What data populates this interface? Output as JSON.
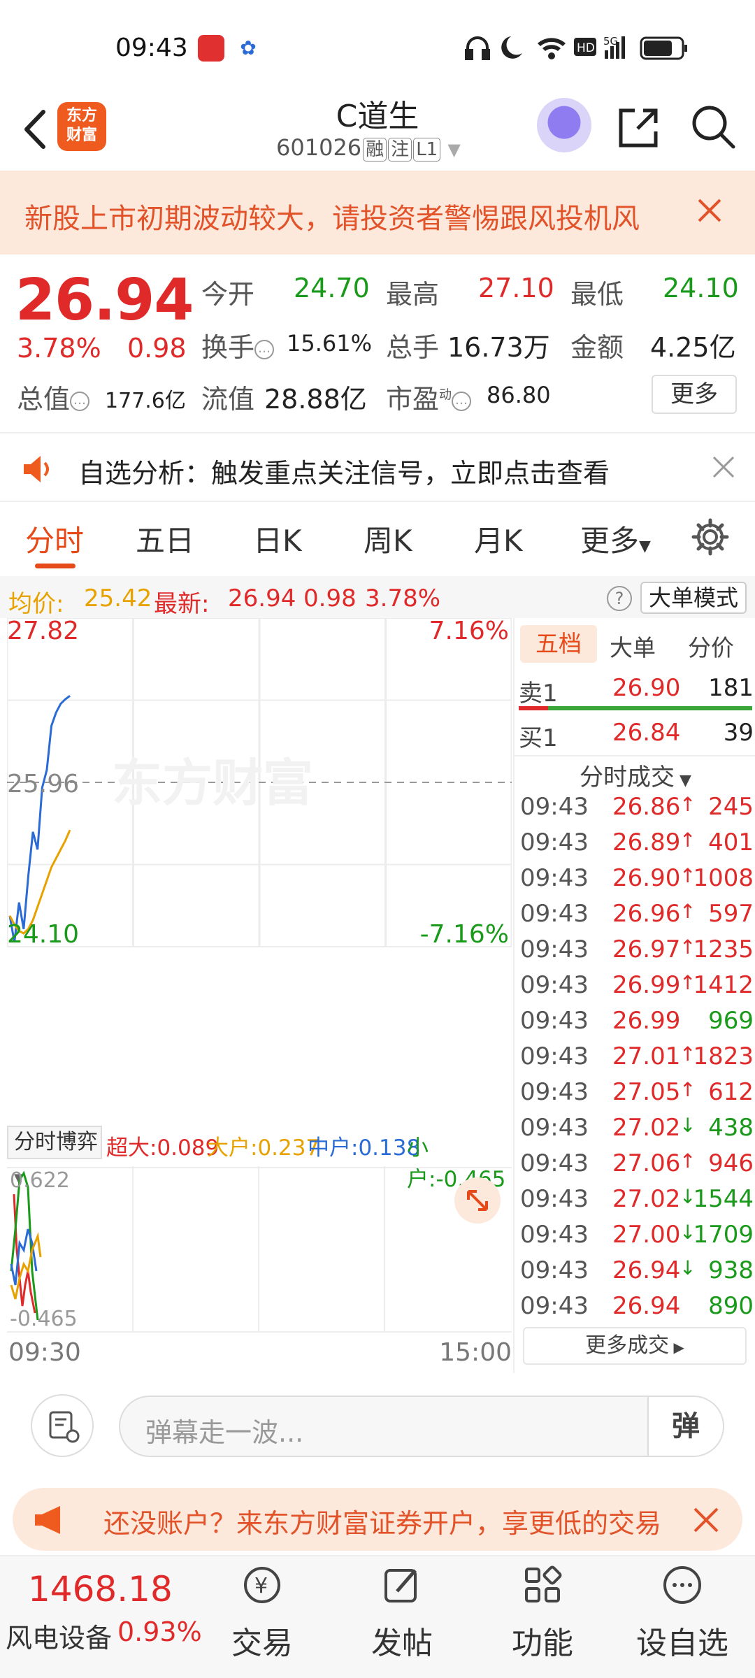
{
  "status_bar": {
    "time": "09:43",
    "network": "5G",
    "hd": "HD"
  },
  "header": {
    "logo_line1": "东方",
    "logo_line2": "财富",
    "title": "C道生",
    "code": "601026",
    "tags": [
      "融",
      "注",
      "L1"
    ]
  },
  "warning": {
    "text": "新股上市初期波动较大，请投资者警惕跟风投机风"
  },
  "quote": {
    "price": "26.94",
    "change_pct": "3.78%",
    "change": "0.98",
    "open_label": "今开",
    "open": "24.70",
    "high_label": "最高",
    "high": "27.10",
    "low_label": "最低",
    "low": "24.10",
    "turnover_label": "换手",
    "turnover": "15.61%",
    "volume_label": "总手",
    "volume": "16.73万",
    "amount_label": "金额",
    "amount": "4.25亿",
    "mktcap_label": "总值",
    "mktcap": "177.6亿",
    "float_label": "流值",
    "float": "28.88亿",
    "pe_label": "市盈",
    "pe_sup": "动",
    "pe": "86.80",
    "more": "更多"
  },
  "notice": {
    "text": "自选分析：触发重点关注信号，立即点击查看"
  },
  "tabs": [
    "分时",
    "五日",
    "日K",
    "周K",
    "月K",
    "更多"
  ],
  "avg_bar": {
    "avg_label": "均价:",
    "avg": "25.42",
    "latest_label": "最新:",
    "latest": "26.94",
    "chg": "0.98",
    "pct": "3.78%",
    "help": "?",
    "mode": "大单模式"
  },
  "chart": {
    "top_price": "27.82",
    "top_pct": "7.16%",
    "mid_price": "25.96",
    "bottom_price": "24.10",
    "bottom_pct": "-7.16%",
    "watermark": "东方财富",
    "flow_select": "分时博弈",
    "flow": [
      {
        "label": "超大:",
        "value": "0.089",
        "color": "#e02a2a"
      },
      {
        "label": "大户:",
        "value": "0.237",
        "color": "#e7a200"
      },
      {
        "label": "中户:",
        "value": "0.138",
        "color": "#2a6bd6"
      },
      {
        "label": "小户:",
        "value": "-0.465",
        "color": "#1a9a1a"
      }
    ],
    "sub_top": "0.622",
    "sub_bottom": "-0.465",
    "time_start": "09:30",
    "time_end": "15:00"
  },
  "chart_data": {
    "type": "line",
    "title": "",
    "x": [
      "09:30",
      "09:31",
      "09:32",
      "09:33",
      "09:34",
      "09:35",
      "09:36",
      "09:37",
      "09:38",
      "09:39",
      "09:40",
      "09:41",
      "09:42",
      "09:43"
    ],
    "xlim": [
      "09:30",
      "15:00"
    ],
    "ylim": [
      24.1,
      27.82
    ],
    "series": [
      {
        "color": "#2a6bd6",
        "values": [
          24.45,
          24.15,
          24.6,
          24.3,
          24.9,
          25.4,
          25.2,
          25.9,
          26.1,
          26.6,
          26.75,
          26.85,
          26.9,
          26.94
        ]
      },
      {
        "color": "#e7a200",
        "values": [
          24.45,
          24.35,
          24.28,
          24.25,
          24.3,
          24.4,
          24.55,
          24.7,
          24.85,
          25.0,
          25.1,
          25.2,
          25.3,
          25.42
        ]
      }
    ]
  },
  "right_panel": {
    "tabs": [
      "五档",
      "大单",
      "分价"
    ],
    "sell1": {
      "label": "卖1",
      "price": "26.90",
      "vol": "181"
    },
    "buy1": {
      "label": "买1",
      "price": "26.84",
      "vol": "39"
    },
    "trades_header": "分时成交",
    "trades": [
      {
        "time": "09:43",
        "price": "26.86",
        "dir": "up",
        "vol": "245"
      },
      {
        "time": "09:43",
        "price": "26.89",
        "dir": "up",
        "vol": "401"
      },
      {
        "time": "09:43",
        "price": "26.90",
        "dir": "up",
        "vol": "1008"
      },
      {
        "time": "09:43",
        "price": "26.96",
        "dir": "up",
        "vol": "597"
      },
      {
        "time": "09:43",
        "price": "26.97",
        "dir": "up",
        "vol": "1235"
      },
      {
        "time": "09:43",
        "price": "26.99",
        "dir": "up",
        "vol": "1412"
      },
      {
        "time": "09:43",
        "price": "26.99",
        "dir": "none",
        "vol": "969"
      },
      {
        "time": "09:43",
        "price": "27.01",
        "dir": "up",
        "vol": "1823"
      },
      {
        "time": "09:43",
        "price": "27.05",
        "dir": "up",
        "vol": "612"
      },
      {
        "time": "09:43",
        "price": "27.02",
        "dir": "down",
        "vol": "438"
      },
      {
        "time": "09:43",
        "price": "27.06",
        "dir": "up",
        "vol": "946"
      },
      {
        "time": "09:43",
        "price": "27.02",
        "dir": "down",
        "vol": "1544"
      },
      {
        "time": "09:43",
        "price": "27.00",
        "dir": "down",
        "vol": "1709"
      },
      {
        "time": "09:43",
        "price": "26.94",
        "dir": "down",
        "vol": "938"
      },
      {
        "time": "09:43",
        "price": "26.94",
        "dir": "none",
        "vol": "890"
      }
    ],
    "more_trades": "更多成交"
  },
  "comment": {
    "placeholder": "弹幕走一波...",
    "danmu": "弹"
  },
  "account_banner": {
    "text": "还没账户？来东方财富证券开户，享更低的交易"
  },
  "bottom_nav": {
    "index_value": "1468.18",
    "index_name": "风电设备",
    "index_change": "0.93%",
    "items": [
      "交易",
      "发帖",
      "功能",
      "设自选"
    ]
  },
  "colors": {
    "red": "#e02a2a",
    "green": "#1a9a1a",
    "orange": "#e64a19",
    "blue": "#2a6bd6",
    "yellow": "#e7a200"
  }
}
